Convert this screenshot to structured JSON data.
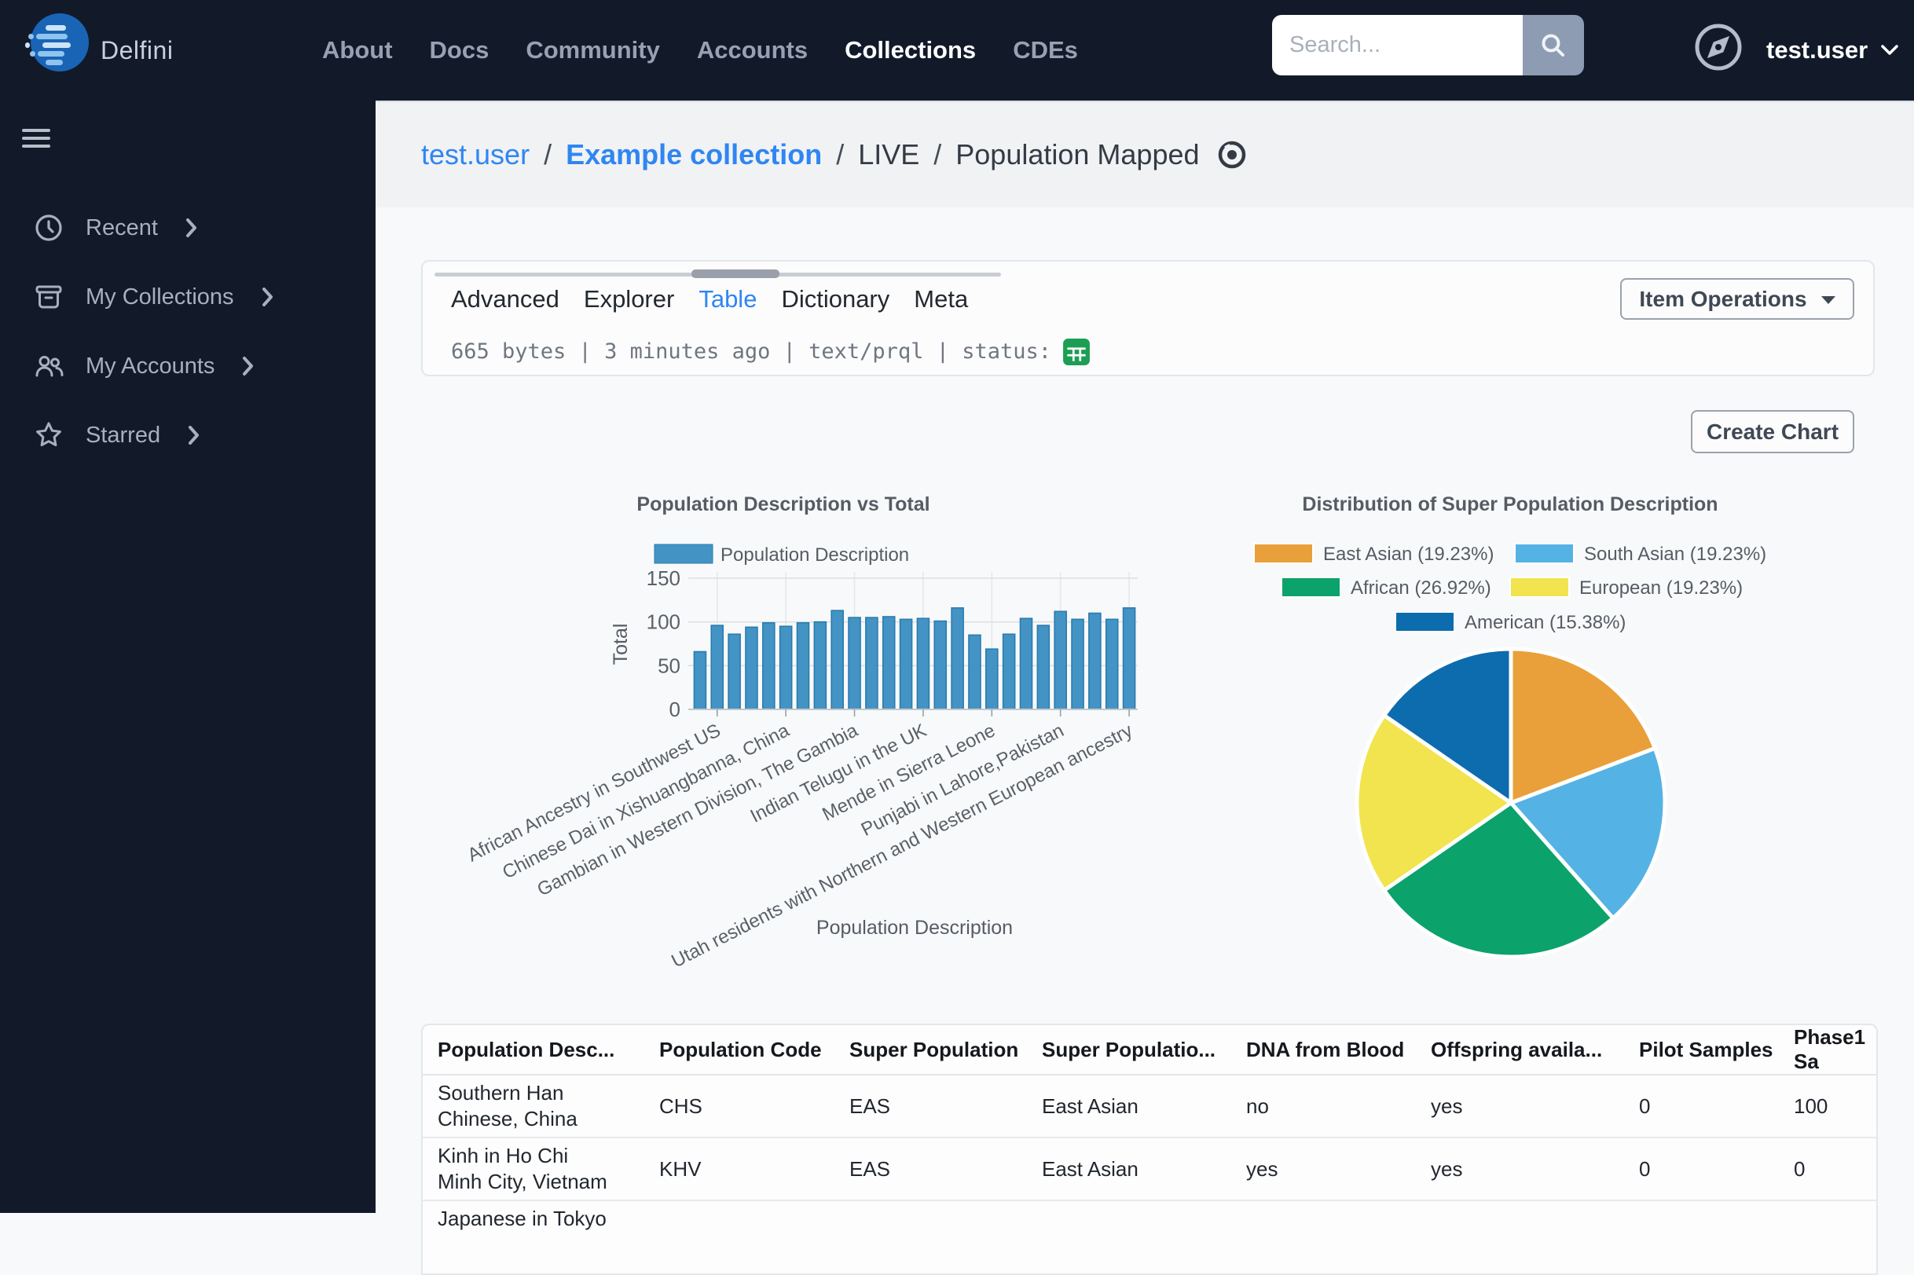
{
  "brand": "Delfini",
  "nav": {
    "items": [
      {
        "label": "About",
        "active": false
      },
      {
        "label": "Docs",
        "active": false
      },
      {
        "label": "Community",
        "active": false
      },
      {
        "label": "Accounts",
        "active": false
      },
      {
        "label": "Collections",
        "active": true
      },
      {
        "label": "CDEs",
        "active": false
      }
    ],
    "search_placeholder": "Search...",
    "search_icon": "magnifier-icon",
    "user_icon": "compass-icon",
    "username": "test.user"
  },
  "sidebar": {
    "menu_icon": "hamburger-icon",
    "items": [
      {
        "label": "Recent",
        "icon": "clock-icon"
      },
      {
        "label": "My Collections",
        "icon": "collections-box-icon"
      },
      {
        "label": "My Accounts",
        "icon": "people-icon"
      },
      {
        "label": "Starred",
        "icon": "star-icon"
      }
    ]
  },
  "breadcrumb": {
    "separator": "/",
    "visibility_icon": "eye-icon",
    "items": [
      {
        "label": "test.user",
        "style": "link"
      },
      {
        "label": "Example collection",
        "style": "link-bold"
      },
      {
        "label": "LIVE",
        "style": "plain"
      },
      {
        "label": "Population Mapped",
        "style": "plain"
      }
    ]
  },
  "item_panel": {
    "tabs": [
      {
        "label": "Advanced",
        "active": false
      },
      {
        "label": "Explorer",
        "active": false
      },
      {
        "label": "Table",
        "active": true
      },
      {
        "label": "Dictionary",
        "active": false
      },
      {
        "label": "Meta",
        "active": false
      }
    ],
    "meta_text": "665 bytes | 3 minutes ago | text/prql | status:",
    "status_icon": "table-grid-icon",
    "status_icon_color": "#1D9E54",
    "operations_button": "Item Operations"
  },
  "actions": {
    "create_chart": "Create Chart"
  },
  "chart_data": [
    {
      "type": "bar",
      "title": "Population Description vs Total",
      "xlabel": "Population Description",
      "ylabel": "Total",
      "ylim": [
        0,
        150
      ],
      "yticks": [
        0,
        50,
        100,
        150
      ],
      "grid": true,
      "legend_position": "top-center",
      "legend": [
        {
          "name": "Population Description",
          "color": "#4394C5"
        }
      ],
      "series": [
        {
          "name": "Population Description",
          "values": [
            66,
            96,
            86,
            94,
            99,
            95,
            99,
            100,
            113,
            105,
            105,
            106,
            103,
            104,
            101,
            116,
            85,
            69,
            86,
            104,
            96,
            112,
            103,
            110,
            103,
            116
          ]
        }
      ],
      "x_tick_labels": [
        {
          "index": 1,
          "label": "African Ancestry in Southwest US"
        },
        {
          "index": 5,
          "label": "Chinese Dai in Xishuangbanna, China"
        },
        {
          "index": 9,
          "label": "Gambian in Western Division, The Gambia"
        },
        {
          "index": 13,
          "label": "Indian Telugu in the UK"
        },
        {
          "index": 17,
          "label": "Mende in Sierra Leone"
        },
        {
          "index": 21,
          "label": "Punjabi in Lahore,Pakistan"
        },
        {
          "index": 25,
          "label": "Utah residents with Northern and Western European ancestry"
        }
      ],
      "bar_color": "#4394C5",
      "bar_border": "#2B7CAE"
    },
    {
      "type": "pie",
      "title": "Distribution of Super Population Description",
      "slices": [
        {
          "label": "East Asian (19.23%)",
          "value": 19.23,
          "color": "#E9A03A"
        },
        {
          "label": "South Asian (19.23%)",
          "value": 19.23,
          "color": "#55B2E4"
        },
        {
          "label": "African (26.92%)",
          "value": 26.92,
          "color": "#0BA26C"
        },
        {
          "label": "European (19.23%)",
          "value": 19.23,
          "color": "#F1E44E"
        },
        {
          "label": "American (15.38%)",
          "value": 15.38,
          "color": "#0C6CAD"
        }
      ],
      "legend_rows": [
        [
          0,
          1
        ],
        [
          2,
          3
        ],
        [
          4
        ]
      ]
    }
  ],
  "table": {
    "columns": [
      "Population Desc...",
      "Population Code",
      "Super Population",
      "Super Populatio...",
      "DNA from Blood",
      "Offspring availa...",
      "Pilot Samples",
      "Phase1 Sa"
    ],
    "rows": [
      [
        "Southern Han Chinese, China",
        "CHS",
        "EAS",
        "East Asian",
        "no",
        "yes",
        "0",
        "100"
      ],
      [
        "Kinh in Ho Chi Minh City, Vietnam",
        "KHV",
        "EAS",
        "East Asian",
        "yes",
        "yes",
        "0",
        "0"
      ],
      [
        "Japanese in Tokyo",
        "",
        "",
        "",
        "",
        "",
        "",
        ""
      ]
    ]
  }
}
